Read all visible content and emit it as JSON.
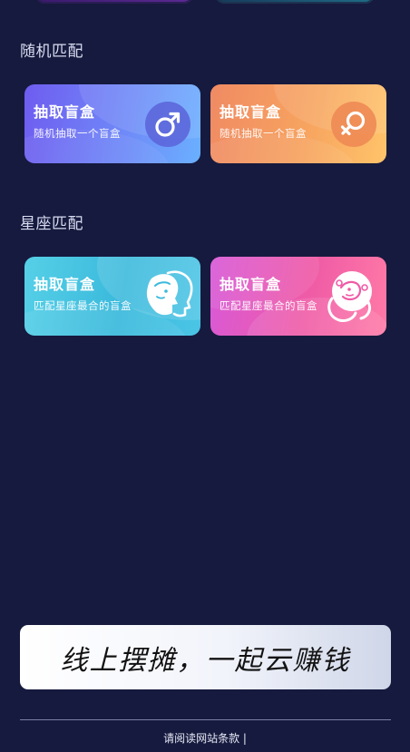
{
  "sections": {
    "random": {
      "title": "随机匹配"
    },
    "zodiac": {
      "title": "星座匹配"
    }
  },
  "cards": {
    "male": {
      "title": "抽取盲盒",
      "subtitle": "随机抽取一个盲盒",
      "icon": "male-symbol-icon"
    },
    "female": {
      "title": "抽取盲盒",
      "subtitle": "随机抽取一个盲盒",
      "icon": "female-symbol-icon"
    },
    "zodiac_a": {
      "title": "抽取盲盒",
      "subtitle": "匹配星座最合的盲盒",
      "icon": "gemini-faces-icon"
    },
    "zodiac_b": {
      "title": "抽取盲盒",
      "subtitle": "匹配星座最合的盲盒",
      "icon": "virgo-lady-icon"
    }
  },
  "banner": {
    "text": "线上摆摊，一起云赚钱"
  },
  "footer": {
    "link": "请阅读网站条款 |"
  },
  "colors": {
    "background": "#161a3e",
    "male_card": "#6f8cf8",
    "female_card": "#f7a460",
    "zodiac_a_card": "#3ab9dc",
    "zodiac_b_card": "#ef5ba6"
  }
}
